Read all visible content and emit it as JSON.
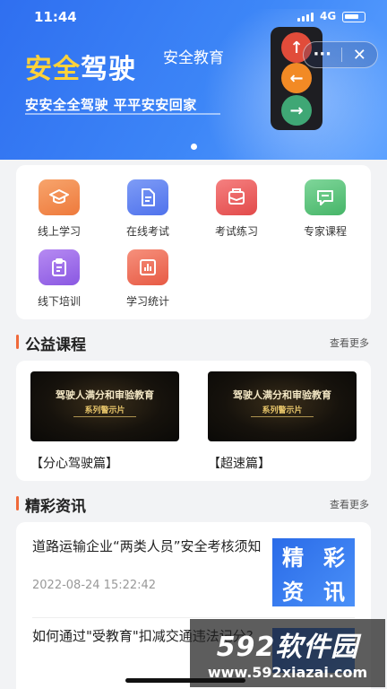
{
  "status_bar": {
    "time": "11:44",
    "network": "4G"
  },
  "hero": {
    "title_highlight": "安全",
    "title_rest": "驾驶",
    "subtitle": "安全教育",
    "slogan": "安安全全驾驶  平平安安回家"
  },
  "capsule": {
    "more": "···",
    "close": "✕"
  },
  "menu": {
    "items": [
      {
        "label": "线上学习",
        "icon": "graduation-cap-icon",
        "color": "#f0834a"
      },
      {
        "label": "在线考试",
        "icon": "document-icon",
        "color": "#5a7ff0"
      },
      {
        "label": "考试练习",
        "icon": "envelope-icon",
        "color": "#ec5a5a"
      },
      {
        "label": "专家课程",
        "icon": "chat-bubble-icon",
        "color": "#56c176"
      },
      {
        "label": "线下培训",
        "icon": "clipboard-icon",
        "color": "#9966e6"
      },
      {
        "label": "学习统计",
        "icon": "bar-chart-icon",
        "color": "#ef6a54"
      }
    ]
  },
  "courses": {
    "title": "公益课程",
    "more": "查看更多",
    "items": [
      {
        "thumb_line1": "驾驶人满分和审验教育",
        "thumb_line2": "系列警示片",
        "title": "【分心驾驶篇】"
      },
      {
        "thumb_line1": "驾驶人满分和审验教育",
        "thumb_line2": "系列警示片",
        "title": "【超速篇】"
      }
    ]
  },
  "news": {
    "title": "精彩资讯",
    "more": "查看更多",
    "items": [
      {
        "title": "道路运输企业“两类人员”安全考核须知",
        "date": "2022-08-24 15:22:42",
        "thumb_chars": [
          "精",
          "彩",
          "资",
          "讯"
        ]
      },
      {
        "title": "如何通过\"受教育\"扣减交通违法记分?"
      }
    ]
  },
  "watermark": {
    "line1": "592软件园",
    "line2": "www.592xiazai.com"
  },
  "colors": {
    "accent": "#f0693a",
    "hero_blue": "#3d86f7",
    "hero_yellow": "#ffd23a"
  }
}
